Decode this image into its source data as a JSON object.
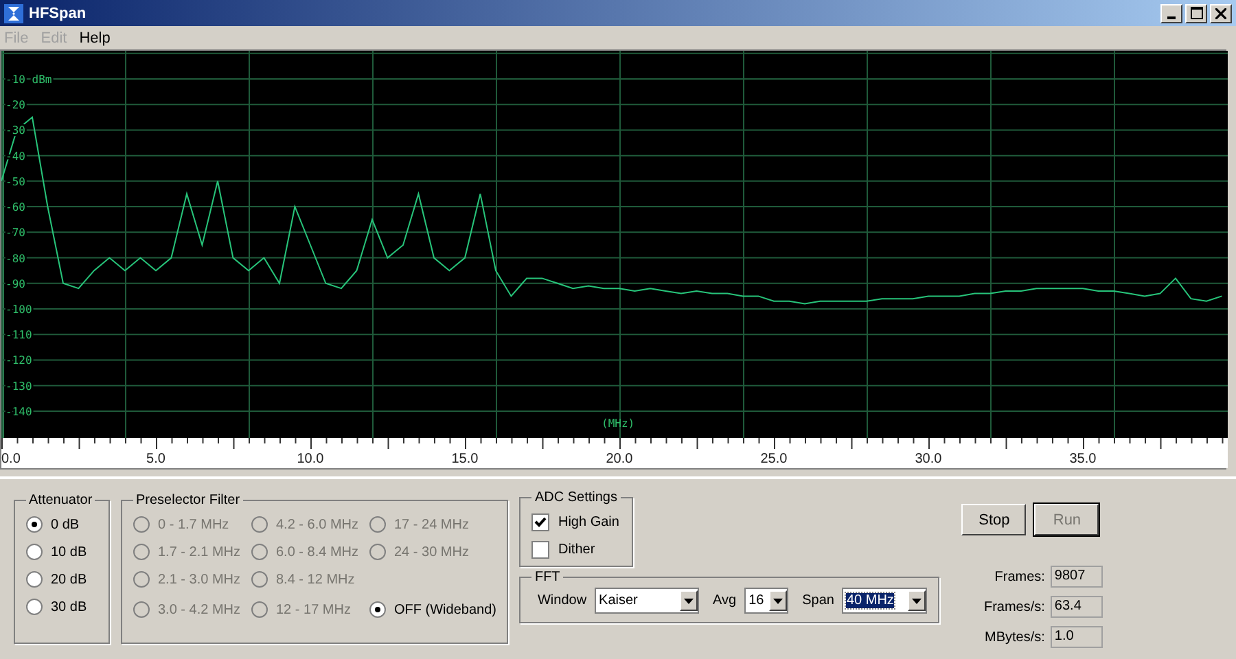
{
  "window": {
    "title": "HFSpan"
  },
  "menu": [
    {
      "label": "File",
      "disabled": true
    },
    {
      "label": "Edit",
      "disabled": true
    },
    {
      "label": "Help",
      "disabled": false
    }
  ],
  "spectrum": {
    "chart_data": {
      "type": "line",
      "grid": true,
      "xlabel": "(MHz)",
      "xlim": [
        0,
        39.69
      ],
      "ylim": [
        -150.5,
        1
      ],
      "xticks": [
        {
          "value": 0,
          "label": "0.0"
        },
        {
          "value": 5,
          "label": "5.0"
        },
        {
          "value": 10,
          "label": "10.0"
        },
        {
          "value": 15,
          "label": "15.0"
        },
        {
          "value": 20,
          "label": "20.0"
        },
        {
          "value": 25,
          "label": "25.0"
        },
        {
          "value": 30,
          "label": "30.0"
        },
        {
          "value": 35,
          "label": "35.0"
        }
      ],
      "yticks": [
        {
          "value": -10,
          "label": "-10 dBm"
        },
        -20,
        -30,
        -40,
        -50,
        -60,
        -70,
        -80,
        -90,
        -100,
        -110,
        -120,
        -130,
        -140
      ],
      "x": [
        0,
        0.5,
        1,
        1.5,
        2,
        2.5,
        3,
        3.5,
        4,
        4.5,
        5,
        5.5,
        6,
        6.5,
        7,
        7.5,
        8,
        8.5,
        9,
        9.5,
        10,
        10.5,
        11,
        11.5,
        12,
        12.5,
        13,
        13.5,
        14,
        14.5,
        15,
        15.5,
        16,
        16.5,
        17,
        17.5,
        18,
        18.5,
        19,
        19.5,
        20,
        20.5,
        21,
        21.5,
        22,
        22.5,
        23,
        23.5,
        24,
        24.5,
        25,
        25.5,
        26,
        26.5,
        27,
        27.5,
        28,
        28.5,
        29,
        29.5,
        30,
        30.5,
        31,
        31.5,
        32,
        32.5,
        33,
        33.5,
        34,
        34.5,
        35,
        35.5,
        36,
        36.5,
        37,
        37.5,
        38,
        38.5,
        39,
        39.5
      ],
      "series": [
        {
          "color": "#27c47a",
          "values": [
            -50,
            -30,
            -25,
            -60,
            -90,
            -92,
            -85,
            -80,
            -85,
            -80,
            -85,
            -80,
            -55,
            -75,
            -50,
            -80,
            -85,
            -80,
            -90,
            -60,
            -75,
            -90,
            -92,
            -85,
            -65,
            -80,
            -75,
            -55,
            -80,
            -85,
            -80,
            -55,
            -85,
            -95,
            -88,
            -88,
            -90,
            -92,
            -91,
            -92,
            -92,
            -93,
            -92,
            -93,
            -94,
            -93,
            -94,
            -94,
            -95,
            -95,
            -97,
            -97,
            -98,
            -97,
            -97,
            -97,
            -97,
            -96,
            -96,
            -96,
            -95,
            -95,
            -95,
            -94,
            -94,
            -93,
            -93,
            -92,
            -92,
            -92,
            -92,
            -93,
            -93,
            -94,
            -95,
            -94,
            -88,
            -96,
            -97,
            -95
          ]
        }
      ]
    }
  },
  "attenuator": {
    "title": "Attenuator",
    "options": [
      {
        "label": "0 dB",
        "selected": true
      },
      {
        "label": "10 dB",
        "selected": false
      },
      {
        "label": "20 dB",
        "selected": false
      },
      {
        "label": "30 dB",
        "selected": false
      }
    ]
  },
  "preselector": {
    "title": "Preselector Filter",
    "columns": [
      [
        {
          "label": "0 - 1.7 MHz",
          "selected": false,
          "disabled": true
        },
        {
          "label": "1.7 - 2.1 MHz",
          "selected": false,
          "disabled": true
        },
        {
          "label": "2.1 - 3.0 MHz",
          "selected": false,
          "disabled": true
        },
        {
          "label": "3.0 - 4.2 MHz",
          "selected": false,
          "disabled": true
        }
      ],
      [
        {
          "label": "4.2 - 6.0 MHz",
          "selected": false,
          "disabled": true
        },
        {
          "label": "6.0 - 8.4 MHz",
          "selected": false,
          "disabled": true
        },
        {
          "label": "8.4 - 12 MHz",
          "selected": false,
          "disabled": true
        },
        {
          "label": "12 - 17 MHz",
          "selected": false,
          "disabled": true
        }
      ],
      [
        {
          "label": "17 - 24 MHz",
          "selected": false,
          "disabled": true
        },
        {
          "label": "24 - 30 MHz",
          "selected": false,
          "disabled": true
        },
        {
          "label": "OFF (Wideband)",
          "selected": true,
          "disabled": false
        }
      ]
    ]
  },
  "adc": {
    "title": "ADC Settings",
    "options": [
      {
        "label": "High Gain",
        "checked": true
      },
      {
        "label": "Dither",
        "checked": false
      }
    ]
  },
  "fft": {
    "title": "FFT",
    "fields": [
      {
        "label": "Window",
        "value": "Kaiser",
        "focused": false
      },
      {
        "label": "Avg",
        "value": "16",
        "focused": false
      },
      {
        "label": "Span",
        "value": "40 MHz",
        "focused": true
      }
    ]
  },
  "buttons": [
    {
      "label": "Stop",
      "disabled": false
    },
    {
      "label": "Run",
      "disabled": true
    }
  ],
  "stats": [
    {
      "label": "Frames:",
      "value": "9807"
    },
    {
      "label": "Frames/s:",
      "value": "63.4"
    },
    {
      "label": "MBytes/s:",
      "value": "1.0"
    }
  ]
}
